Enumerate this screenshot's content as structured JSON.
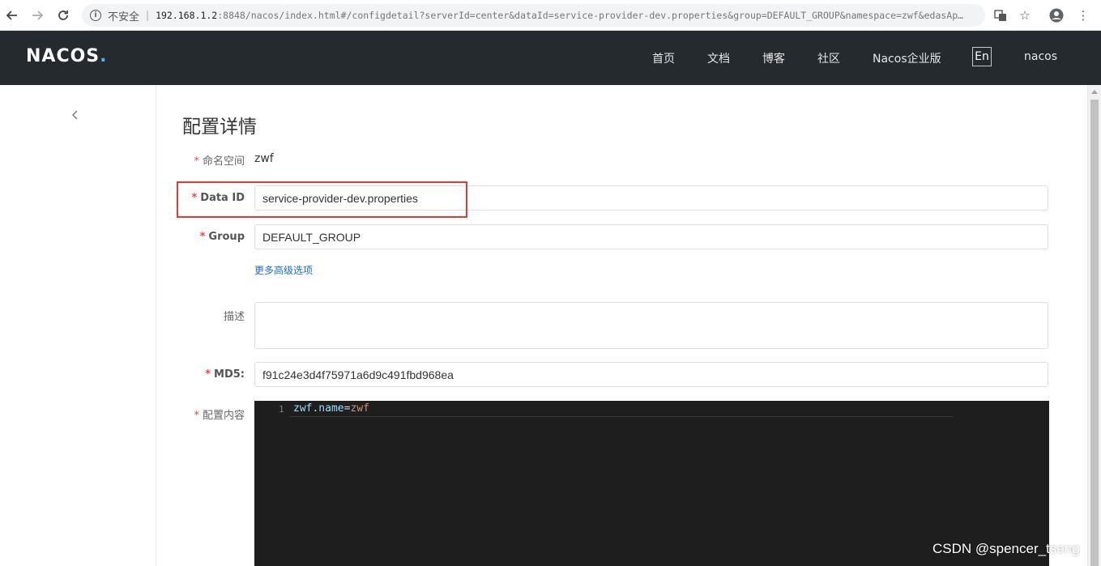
{
  "browser": {
    "insecure_label": "不安全",
    "url_host": "192.168.1.2",
    "url_rest": ":8848/nacos/index.html#/configdetail?serverId=center&dataId=service-provider-dev.properties&group=DEFAULT_GROUP&namespace=zwf&edasAp…"
  },
  "header": {
    "logo_main": "NACOS",
    "logo_dot": ".",
    "nav": [
      "首页",
      "文档",
      "博客",
      "社区",
      "Nacos企业版"
    ],
    "lang": "En",
    "user": "nacos"
  },
  "page": {
    "title": "配置详情"
  },
  "form": {
    "namespace_label": "命名空间",
    "namespace_value": "zwf",
    "dataid_label": "Data ID",
    "dataid_value": "service-provider-dev.properties",
    "group_label": "Group",
    "group_value": "DEFAULT_GROUP",
    "advanced_link": "更多高级选项",
    "desc_label": "描述",
    "md5_label": "MD5:",
    "md5_value": "f91c24e3d4f75971a6d9c491fbd968ea",
    "content_label": "配置内容",
    "required_mark": "*"
  },
  "editor": {
    "line_number": "1",
    "code_key": "zwf.name",
    "code_eq": "=",
    "code_value": "zwf"
  },
  "watermark": "CSDN @spencer_tseng"
}
